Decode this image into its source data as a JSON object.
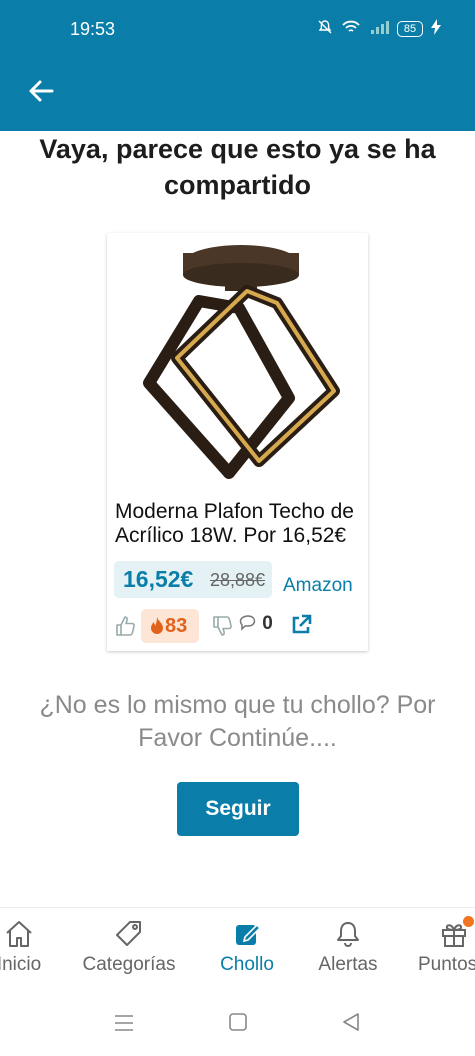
{
  "status_bar": {
    "time": "19:53",
    "battery": "85"
  },
  "headline": "Vaya, parece que esto ya se ha compartido",
  "deal": {
    "title": "Moderna Plafon Techo de Acrílico 18W. Por 16,52€",
    "price": "16,52€",
    "old_price": "28,88€",
    "merchant": "Amazon",
    "temperature": "83",
    "comments": "0"
  },
  "question": "¿No es lo mismo que tu chollo? Por Favor Continúe....",
  "continue_label": "Seguir",
  "bottom_nav": [
    {
      "label": "Inicio",
      "icon": "home-icon"
    },
    {
      "label": "Categorías",
      "icon": "tag-icon"
    },
    {
      "label": "Chollo",
      "icon": "edit-icon"
    },
    {
      "label": "Alertas",
      "icon": "bell-icon"
    },
    {
      "label": "Puntos",
      "icon": "gift-icon"
    }
  ],
  "colors": {
    "primary": "#0a7ea8",
    "hot": "#e2621b",
    "hot_bg": "#fde6d6",
    "price_bg": "#e4f2f6"
  }
}
